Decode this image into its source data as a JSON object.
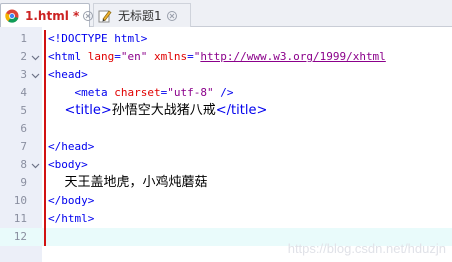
{
  "tabs": [
    {
      "label": "1.html *",
      "icon": "chrome-icon",
      "active": true
    },
    {
      "label": "无标题1",
      "icon": "pencil-icon",
      "active": false
    }
  ],
  "lines": [
    {
      "n": "1",
      "fold": "",
      "tokens": [
        [
          "tag",
          "<!DOCTYPE html>"
        ]
      ]
    },
    {
      "n": "2",
      "fold": "minus",
      "tokens": [
        [
          "tag",
          "<html "
        ],
        [
          "attr",
          "lang"
        ],
        [
          "tag",
          "="
        ],
        [
          "str",
          "\"en\""
        ],
        [
          "tag",
          " "
        ],
        [
          "attr",
          "xmlns"
        ],
        [
          "tag",
          "="
        ],
        [
          "str",
          "\""
        ],
        [
          "url",
          "http://www.w3.org/1999/xhtml"
        ]
      ]
    },
    {
      "n": "3",
      "fold": "minus",
      "tokens": [
        [
          "tag",
          "<head>"
        ]
      ]
    },
    {
      "n": "4",
      "fold": "",
      "tokens": [
        [
          "txt",
          "    "
        ],
        [
          "tag",
          "<meta "
        ],
        [
          "attr",
          "charset"
        ],
        [
          "tag",
          "="
        ],
        [
          "str",
          "\"utf-8\""
        ],
        [
          "tag",
          " />"
        ]
      ]
    },
    {
      "n": "5",
      "fold": "",
      "cn": true,
      "tokens": [
        [
          "txt",
          "    "
        ],
        [
          "tag",
          "<title>"
        ],
        [
          "txt",
          "孙悟空大战猪八戒"
        ],
        [
          "tag",
          "</title>"
        ]
      ]
    },
    {
      "n": "6",
      "fold": "",
      "tokens": []
    },
    {
      "n": "7",
      "fold": "",
      "tokens": [
        [
          "tag",
          "</head>"
        ]
      ]
    },
    {
      "n": "8",
      "fold": "minus",
      "tokens": [
        [
          "tag",
          "<body>"
        ]
      ]
    },
    {
      "n": "9",
      "fold": "",
      "cn": true,
      "tokens": [
        [
          "txt",
          "    天王盖地虎，小鸡炖蘑菇"
        ]
      ]
    },
    {
      "n": "10",
      "fold": "",
      "tokens": [
        [
          "tag",
          "</body>"
        ]
      ]
    },
    {
      "n": "11",
      "fold": "",
      "tokens": [
        [
          "tag",
          "</html>"
        ]
      ]
    },
    {
      "n": "12",
      "fold": "",
      "current": true,
      "tokens": []
    }
  ],
  "watermark": "https://blog.csdn.net/hduzjn"
}
